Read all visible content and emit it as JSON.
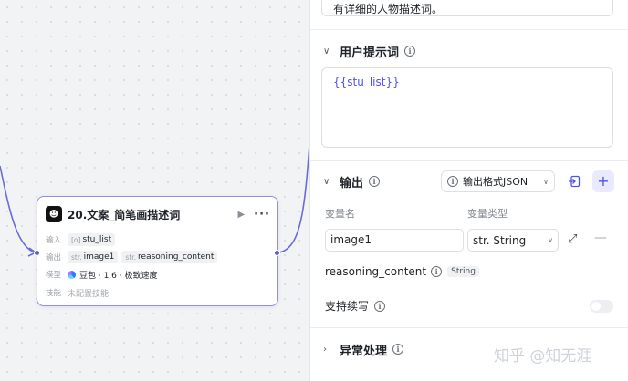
{
  "canvas": {
    "node": {
      "title": "20.文案_简笔画描述词",
      "logo_icon": "robot-icon",
      "input_label": "输入",
      "input_var": {
        "type": "[o]",
        "name": "stu_list"
      },
      "output_label": "输出",
      "output_vars": [
        {
          "type": "str.",
          "name": "image1"
        },
        {
          "type": "str.",
          "name": "reasoning_content"
        }
      ],
      "model_label": "模型",
      "model_value": "豆包 · 1.6 · 极致速度",
      "skill_label": "技能",
      "skill_value": "未配置技能"
    }
  },
  "panel": {
    "description_text": "有详细的人物描述词。",
    "user_prompt": {
      "title": "用户提示词",
      "value": "{{stu_list}}"
    },
    "output": {
      "title": "输出",
      "format_label": "输出格式JSON",
      "col_var_name": "变量名",
      "col_var_type": "变量类型",
      "var_name": "image1",
      "var_type": "str. String",
      "reasoning_name": "reasoning_content",
      "reasoning_type": "String",
      "stream_label": "支持续写"
    },
    "exception": {
      "title": "异常处理"
    }
  },
  "watermark": "知乎 @知无涯",
  "colors": {
    "accent": "#4d53e8",
    "node_border": "#8f8fe9",
    "connector": "#6b6bdb"
  }
}
